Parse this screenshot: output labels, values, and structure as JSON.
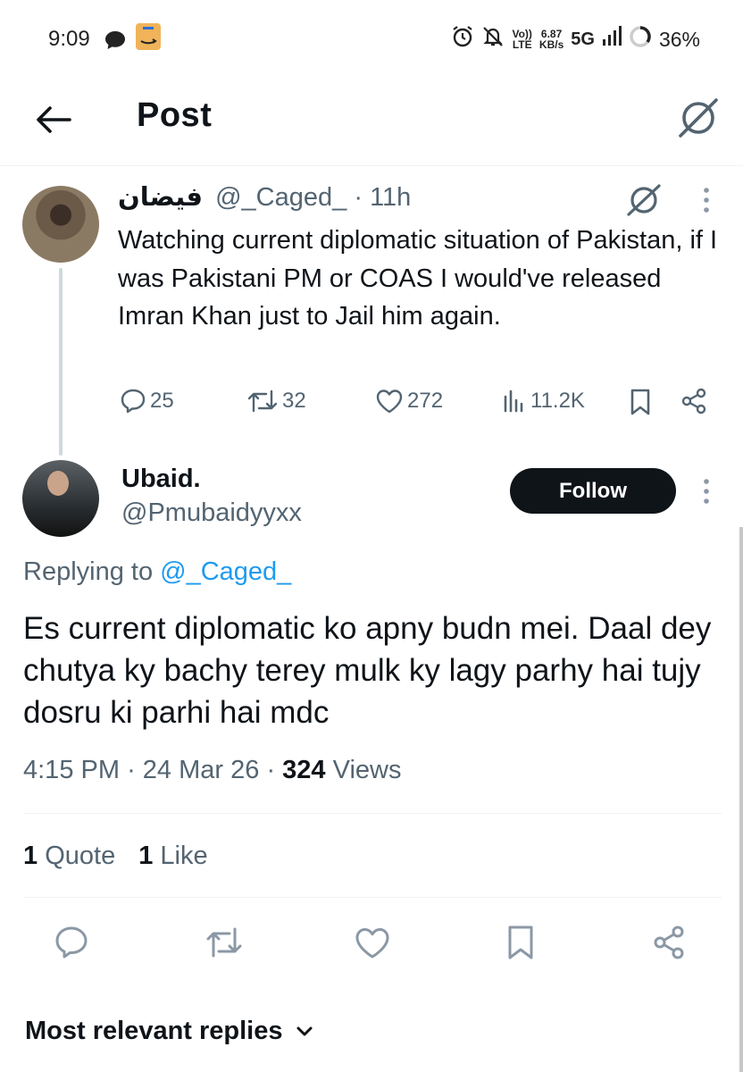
{
  "status_bar": {
    "time": "9:09",
    "net_speed_value": "6.87",
    "net_speed_unit": "KB/s",
    "volte_top": "Vo))",
    "volte_bottom": "LTE",
    "network": "5G",
    "battery": "36%"
  },
  "header": {
    "title": "Post"
  },
  "parent_tweet": {
    "name": "فيضان",
    "handle": "@_Caged_",
    "separator": "·",
    "time": "11h",
    "text": "Watching current diplomatic situation of Pakistan, if I was Pakistani PM or COAS I would've released Imran Khan just to Jail him again.",
    "replies": "25",
    "reposts": "32",
    "likes": "272",
    "views": "11.2K"
  },
  "reply_tweet": {
    "name": "Ubaid.",
    "handle": "@Pmubaidyyxx",
    "follow_label": "Follow",
    "replying_prefix": "Replying to",
    "replying_to": "@_Caged_",
    "text": "Es current diplomatic ko apny budn mei. Daal dey chutya ky bachy terey mulk ky lagy parhy hai tujy dosru ki parhi hai mdc",
    "time": "4:15 PM",
    "date": "24 Mar 26",
    "views_count": "324",
    "views_label": "Views",
    "quote_count": "1",
    "quote_label": "Quote",
    "like_count": "1",
    "like_label": "Like"
  },
  "replies_sort": {
    "label": "Most relevant replies"
  },
  "colors": {
    "text": "#0f1419",
    "secondary": "#536471",
    "accent": "#1d9bf0",
    "follow_bg": "#0f1419"
  }
}
